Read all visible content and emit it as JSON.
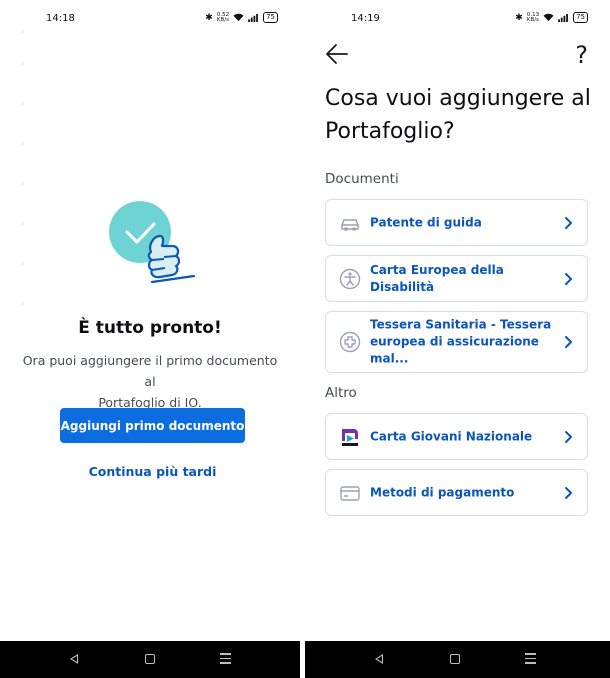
{
  "left": {
    "time": "14:18",
    "net_speed": "0.52\nKB/s",
    "battery": "75",
    "title": "È tutto pronto!",
    "body_line1": "Ora puoi aggiungere il primo documento al",
    "body_line2": "Portafoglio di IO.",
    "primary_button": "Aggiungi primo documento",
    "secondary_link": "Continua più tardi"
  },
  "right": {
    "time": "14:19",
    "net_speed": "0.13\nKB/s",
    "battery": "75",
    "title": "Cosa vuoi aggiungere al Portafoglio?",
    "section_documents": "Documenti",
    "section_other": "Altro",
    "items": [
      {
        "label": "Patente di guida",
        "icon": "car-icon"
      },
      {
        "label": "Carta Europea della Disabilità",
        "icon": "accessibility-icon"
      },
      {
        "label": "Tessera Sanitaria - Tessera europea di assicurazione mal...",
        "icon": "health-card-icon"
      },
      {
        "label": "Carta Giovani Nazionale",
        "icon": "cgn-logo-icon"
      },
      {
        "label": "Metodi di pagamento",
        "icon": "credit-card-icon"
      }
    ]
  },
  "colors": {
    "primary": "#0b6de0",
    "link": "#0b56b8",
    "accent_teal": "#6fd3d6",
    "border": "#d9dee6"
  }
}
